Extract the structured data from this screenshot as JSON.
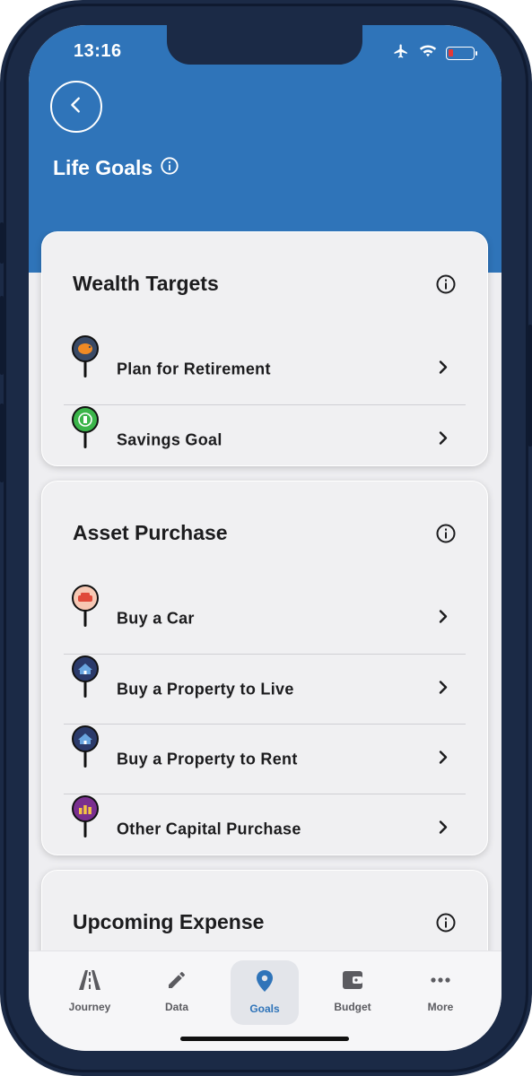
{
  "status_bar": {
    "time": "13:16"
  },
  "header": {
    "title": "Life Goals"
  },
  "sections": [
    {
      "title": "Wealth Targets",
      "items": [
        {
          "label": "Plan for Retirement",
          "icon": "piggy-bank-icon",
          "color": "#f08a24",
          "ring": "#3a4a66"
        },
        {
          "label": "Savings Goal",
          "icon": "pound-savings-icon",
          "color": "#3bb54a",
          "ring": "#2c6e33"
        }
      ]
    },
    {
      "title": "Asset Purchase",
      "items": [
        {
          "label": "Buy a Car",
          "icon": "car-icon",
          "color": "#f7c8b4",
          "ring": "#e04a3a"
        },
        {
          "label": "Buy a Property to Live",
          "icon": "house-icon",
          "color": "#6aa6e0",
          "ring": "#2b3a6a"
        },
        {
          "label": "Buy a Property to Rent",
          "icon": "house-icon",
          "color": "#6aa6e0",
          "ring": "#2b3a6a"
        },
        {
          "label": "Other Capital Purchase",
          "icon": "chart-bars-icon",
          "color": "#7a2f8f",
          "ring": "#4a1a55"
        }
      ]
    },
    {
      "title": "Upcoming Expense",
      "items": []
    }
  ],
  "tabs": [
    {
      "label": "Journey",
      "icon": "road-icon",
      "active": false
    },
    {
      "label": "Data",
      "icon": "pencil-icon",
      "active": false
    },
    {
      "label": "Goals",
      "icon": "location-pin-icon",
      "active": true
    },
    {
      "label": "Budget",
      "icon": "wallet-icon",
      "active": false
    },
    {
      "label": "More",
      "icon": "more-dots-icon",
      "active": false
    }
  ],
  "colors": {
    "accent": "#2f74b9",
    "background": "#eeeef1",
    "card": "#f0f0f2"
  }
}
